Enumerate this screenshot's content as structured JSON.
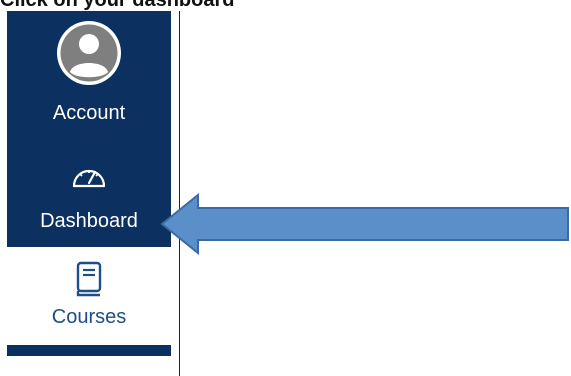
{
  "instruction": "Click on your dashboard",
  "nav": {
    "items": [
      {
        "label": "Account",
        "icon": "user-avatar-icon"
      },
      {
        "label": "Dashboard",
        "icon": "dashboard-gauge-icon"
      },
      {
        "label": "Courses",
        "icon": "book-icon"
      }
    ]
  },
  "colors": {
    "nav_background": "#0c3060",
    "nav_text": "#ffffff",
    "courses_text": "#1c4f8a",
    "arrow_fill": "#5b8fc9",
    "arrow_stroke": "#3b6aa3"
  }
}
